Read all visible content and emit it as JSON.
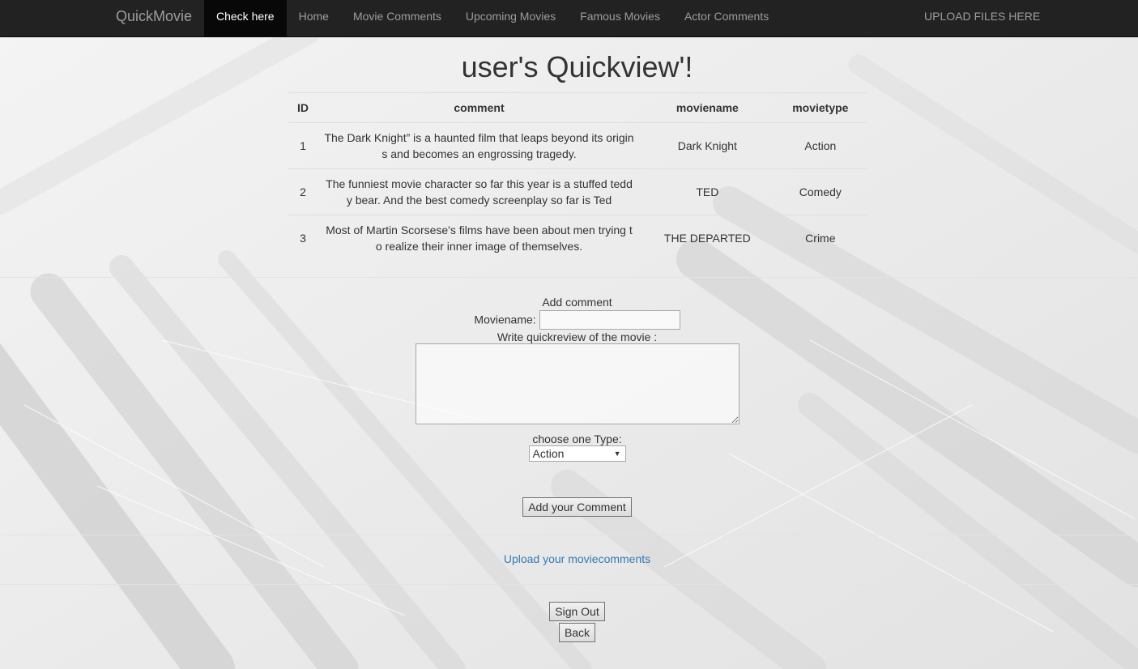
{
  "nav": {
    "brand": "QuickMovie",
    "items": [
      {
        "label": "Check here",
        "active": true
      },
      {
        "label": "Home",
        "active": false
      },
      {
        "label": "Movie Comments",
        "active": false
      },
      {
        "label": "Upcoming Movies",
        "active": false
      },
      {
        "label": "Famous Movies",
        "active": false
      },
      {
        "label": "Actor Comments",
        "active": false
      }
    ],
    "right_label": "UPLOAD FILES HERE"
  },
  "page": {
    "title": "user's Quickview'!"
  },
  "table": {
    "headers": [
      "ID",
      "comment",
      "moviename",
      "movietype"
    ],
    "rows": [
      {
        "id": "1",
        "comment": "The Dark Knight” is a haunted film that leaps beyond its origins and becomes an engrossing tragedy.",
        "moviename": "Dark Knight",
        "movietype": "Action"
      },
      {
        "id": "2",
        "comment": "The funniest movie character so far this year is a stuffed teddy bear. And the best comedy screenplay so far is Ted",
        "moviename": "TED",
        "movietype": "Comedy"
      },
      {
        "id": "3",
        "comment": "Most of Martin Scorsese's films have been about men trying to realize their inner image of themselves.",
        "moviename": "THE DEPARTED",
        "movietype": "Crime"
      }
    ]
  },
  "form": {
    "heading": "Add comment",
    "moviename_label": "Moviename:",
    "moviename_value": "",
    "review_label": "Write quickreview of the movie :",
    "review_value": "",
    "type_label": "choose one Type:",
    "type_selected": "Action",
    "submit_label": "Add your Comment"
  },
  "upload_link": "Upload your moviecomments",
  "buttons": {
    "sign_out": "Sign Out",
    "back": "Back"
  },
  "colors": {
    "navbar": "#222222",
    "nav_active": "#080808",
    "link": "#337ab7"
  }
}
